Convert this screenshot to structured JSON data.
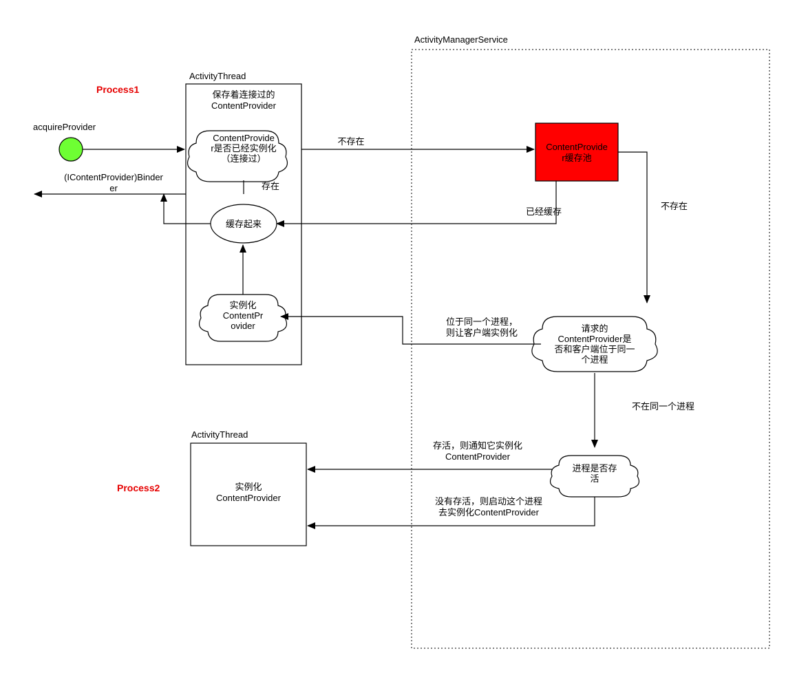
{
  "labels": {
    "process1": "Process1",
    "process2": "Process2",
    "acquireProvider": "acquireProvider",
    "binderReturn": "(IContentProvider)Binder",
    "activityThread1": "ActivityThread",
    "activityThread2": "ActivityThread",
    "ams": "ActivityManagerService"
  },
  "boxes": {
    "at1_sub": [
      "保存着连接过的",
      "ContentProvider"
    ],
    "cache_pool": [
      "ContentProvide",
      "r缓存池"
    ],
    "inst2": [
      "实例化",
      "ContentProvider"
    ]
  },
  "clouds": {
    "cp_instantiated": [
      "ContentProvide",
      "r是否已经实例化",
      "（连接过）"
    ],
    "cache_it": [
      "缓存起来"
    ],
    "inst_cp": [
      "实例化",
      "ContentPr",
      "ovider"
    ],
    "same_proc": [
      "请求的",
      "ContentProvider是",
      "否和客户端位于同一",
      "个进程"
    ],
    "proc_alive": [
      "进程是否存",
      "活"
    ]
  },
  "edges": {
    "not_exist1": "不存在",
    "exist": "存在",
    "not_exist2": "不存在",
    "already_cached": "已经缓存",
    "same_proc_yes": [
      "位于同一个进程，",
      "则让客户端实例化"
    ],
    "diff_proc": "不在同一个进程",
    "alive": [
      "存活，则通知它实例化",
      "ContentProvider"
    ],
    "not_alive": [
      "没有存活，则启动这个进程",
      "去实例化ContentProvider"
    ]
  }
}
